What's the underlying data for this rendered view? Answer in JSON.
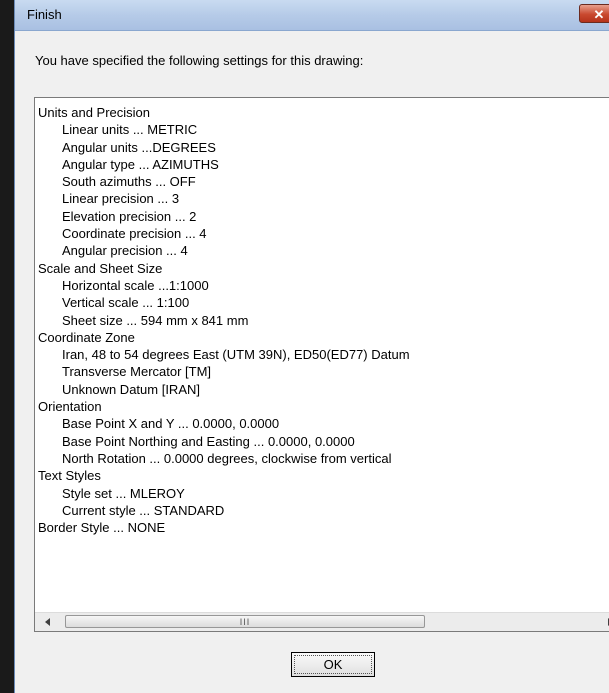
{
  "window": {
    "title": "Finish",
    "close_label": "✕"
  },
  "prompt": "You have specified the following settings for this drawing:",
  "settings_lines": [
    {
      "text": "Units and Precision",
      "indent": false
    },
    {
      "text": "Linear units ... METRIC",
      "indent": true
    },
    {
      "text": "Angular units ...DEGREES",
      "indent": true
    },
    {
      "text": "Angular type ... AZIMUTHS",
      "indent": true
    },
    {
      "text": "South azimuths ... OFF",
      "indent": true
    },
    {
      "text": "Linear precision ... 3",
      "indent": true
    },
    {
      "text": "Elevation precision ... 2",
      "indent": true
    },
    {
      "text": "Coordinate precision ... 4",
      "indent": true
    },
    {
      "text": "Angular precision ... 4",
      "indent": true
    },
    {
      "text": "Scale and Sheet Size",
      "indent": false
    },
    {
      "text": "Horizontal scale ...1:1000",
      "indent": true
    },
    {
      "text": "Vertical scale ... 1:100",
      "indent": true
    },
    {
      "text": "Sheet size ... 594 mm x 841 mm",
      "indent": true
    },
    {
      "text": "Coordinate Zone",
      "indent": false
    },
    {
      "text": "Iran, 48 to 54 degrees East (UTM 39N), ED50(ED77) Datum",
      "indent": true
    },
    {
      "text": "Transverse Mercator [TM]",
      "indent": true
    },
    {
      "text": "Unknown Datum [IRAN]",
      "indent": true
    },
    {
      "text": "Orientation",
      "indent": false
    },
    {
      "text": "Base Point X and Y ...  0.0000,  0.0000",
      "indent": true
    },
    {
      "text": "Base Point Northing and Easting ...  0.0000,  0.0000",
      "indent": true
    },
    {
      "text": "North Rotation ... 0.0000 degrees, clockwise from vertical",
      "indent": true
    },
    {
      "text": "Text Styles",
      "indent": false
    },
    {
      "text": "Style set ... MLEROY",
      "indent": true
    },
    {
      "text": "Current style ... STANDARD",
      "indent": true
    },
    {
      "text": "Border Style ... NONE",
      "indent": false
    }
  ],
  "scrollbar": {
    "grip": "III"
  },
  "buttons": {
    "ok_label": "OK"
  }
}
